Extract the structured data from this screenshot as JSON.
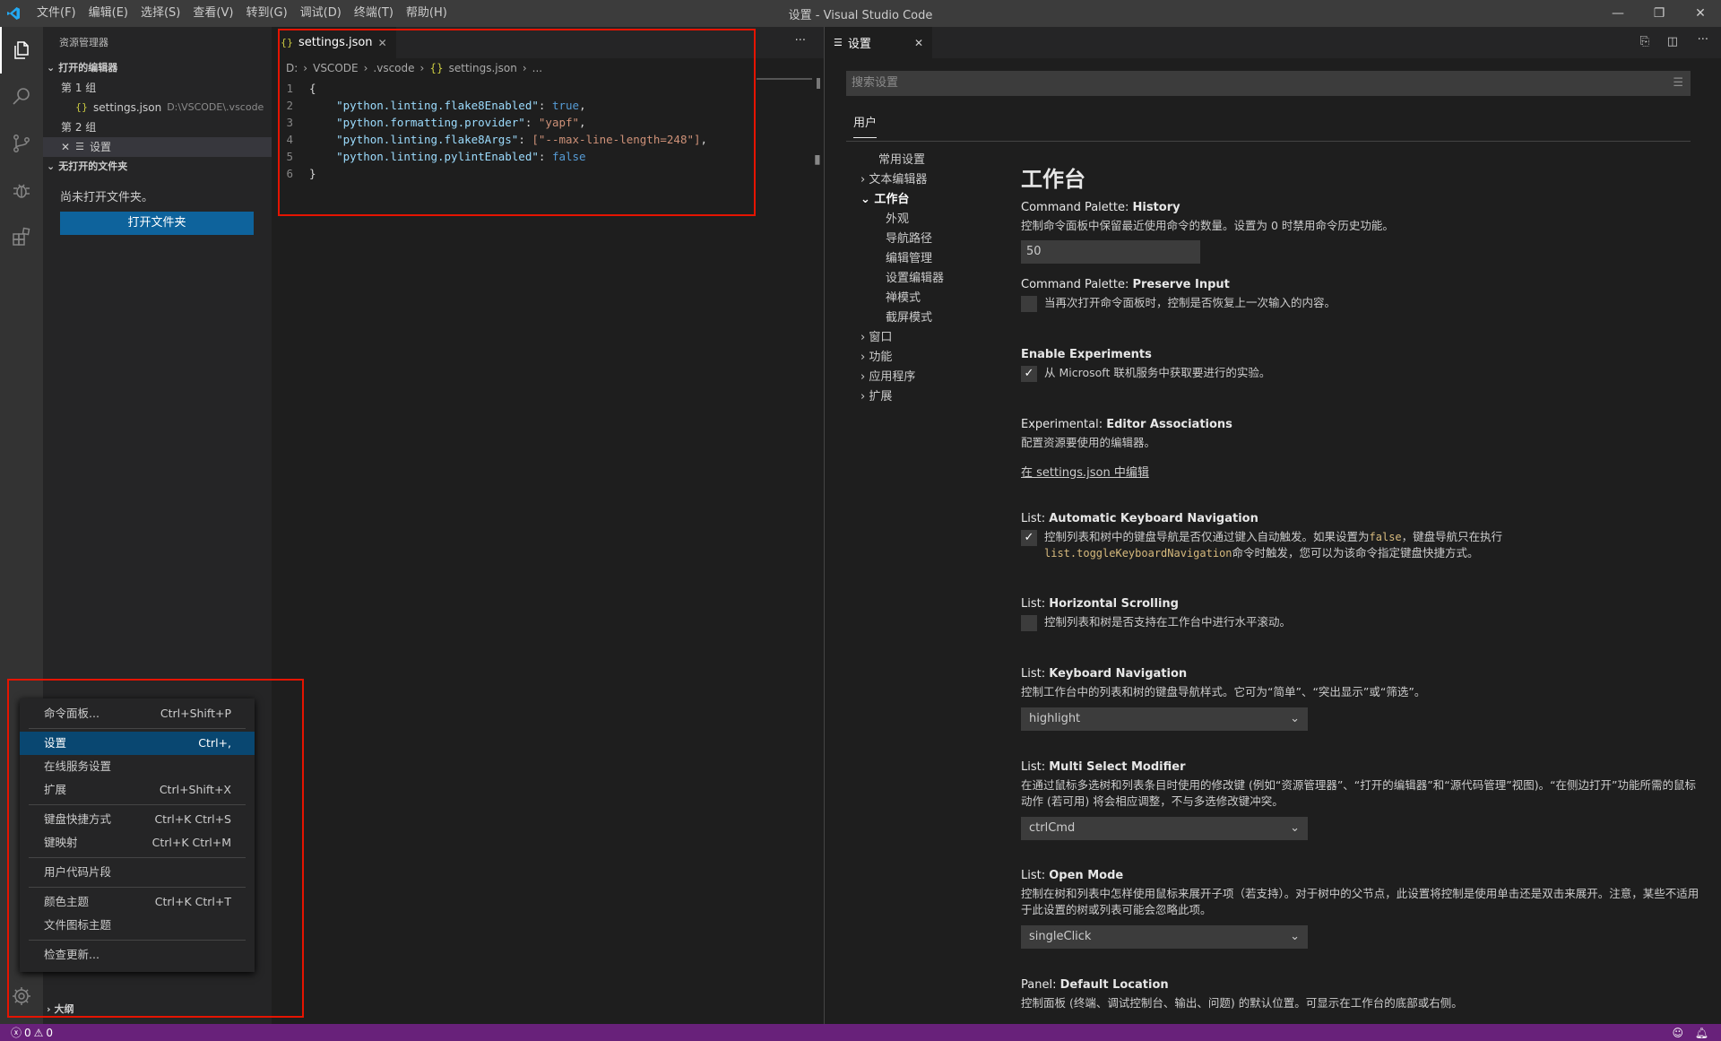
{
  "titlebar": {
    "title": "设置 - Visual Studio Code",
    "menu": [
      "文件(F)",
      "编辑(E)",
      "选择(S)",
      "查看(V)",
      "转到(G)",
      "调试(D)",
      "终端(T)",
      "帮助(H)"
    ],
    "controls": {
      "minimize": "—",
      "restore": "❐",
      "close": "✕"
    }
  },
  "activity_bar": {
    "icons": [
      "files-icon",
      "search-icon",
      "source-control-icon",
      "debug-icon",
      "extensions-icon",
      "gear-icon"
    ]
  },
  "sidebar": {
    "header": "资源管理器",
    "open_editors": {
      "title": "打开的编辑器",
      "groups": [
        {
          "label": "第 1 组",
          "items": [
            {
              "name": "settings.json",
              "path": "D:\\VSCODE\\.vscode"
            }
          ]
        },
        {
          "label": "第 2 组",
          "items": [
            {
              "name": "设置",
              "path": ""
            }
          ]
        }
      ]
    },
    "no_folder": {
      "title": "无打开的文件夹",
      "message": "尚未打开文件夹。",
      "button": "打开文件夹"
    },
    "outline": "大纲"
  },
  "editor": {
    "tab": "settings.json",
    "more": "···",
    "breadcrumb": [
      "D:",
      "VSCODE",
      ".vscode",
      "settings.json",
      "..."
    ],
    "lines": [
      {
        "n": "1",
        "text": "{"
      },
      {
        "n": "2",
        "key": "\"python.linting.flake8Enabled\"",
        "val": "true",
        "type": "kw",
        "end": ","
      },
      {
        "n": "3",
        "key": "\"python.formatting.provider\"",
        "val": "\"yapf\"",
        "type": "str",
        "end": ","
      },
      {
        "n": "4",
        "key": "\"python.linting.flake8Args\"",
        "val": "[\"--max-line-length=248\"]",
        "type": "str",
        "end": ","
      },
      {
        "n": "5",
        "key": "\"python.linting.pylintEnabled\"",
        "val": "false",
        "type": "kw",
        "end": ""
      },
      {
        "n": "6",
        "text": "}"
      }
    ]
  },
  "settings": {
    "tab": "设置",
    "search_placeholder": "搜索设置",
    "scope_tab": "用户",
    "toc": [
      "常用设置",
      "文本编辑器",
      "工作台",
      "外观",
      "导航路径",
      "编辑管理",
      "设置编辑器",
      "禅模式",
      "截屏模式",
      "窗口",
      "功能",
      "应用程序",
      "扩展"
    ],
    "section_title": "工作台",
    "items": [
      {
        "prefix": "Command Palette: ",
        "name": "History",
        "desc": "控制命令面板中保留最近使用命令的数量。设置为 0 时禁用命令历史功能。",
        "value": "50"
      },
      {
        "prefix": "Command Palette: ",
        "name": "Preserve Input",
        "desc": "当再次打开命令面板时，控制是否恢复上一次输入的内容。"
      },
      {
        "prefix": "",
        "name": "Enable Experiments",
        "desc": "从 Microsoft 联机服务中获取要进行的实验。"
      },
      {
        "prefix": "Experimental: ",
        "name": "Editor Associations",
        "desc": "配置资源要使用的编辑器。",
        "link": "在 settings.json 中编辑"
      },
      {
        "prefix": "List: ",
        "name": "Automatic Keyboard Navigation",
        "desc1": "控制列表和树中的键盘导航是否仅通过键入自动触发。如果设置为",
        "code1": "false",
        "desc2": "，键盘导航只在执行",
        "code2": "list.toggleKeyboardNavigation",
        "desc3": "命令时触发，您可以为该命令指定键盘快捷方式。"
      },
      {
        "prefix": "List: ",
        "name": "Horizontal Scrolling",
        "desc": "控制列表和树是否支持在工作台中进行水平滚动。"
      },
      {
        "prefix": "List: ",
        "name": "Keyboard Navigation",
        "desc": "控制工作台中的列表和树的键盘导航样式。它可为“简单”、“突出显示”或“筛选”。",
        "value": "highlight"
      },
      {
        "prefix": "List: ",
        "name": "Multi Select Modifier",
        "desc": "在通过鼠标多选树和列表条目时使用的修改键 (例如“资源管理器”、“打开的编辑器”和“源代码管理”视图)。“在侧边打开”功能所需的鼠标动作 (若可用) 将会相应调整，不与多选修改键冲突。",
        "value": "ctrlCmd"
      },
      {
        "prefix": "List: ",
        "name": "Open Mode",
        "desc": "控制在树和列表中怎样使用鼠标来展开子项（若支持）。对于树中的父节点，此设置将控制是使用单击还是双击来展开。注意，某些不适用于此设置的树或列表可能会忽略此项。",
        "value": "singleClick"
      },
      {
        "prefix": "Panel: ",
        "name": "Default Location",
        "desc": "控制面板 (终端、调试控制台、输出、问题) 的默认位置。可显示在工作台的底部或右侧。"
      }
    ]
  },
  "context_menu": {
    "items": [
      {
        "label": "命令面板...",
        "shortcut": "Ctrl+Shift+P"
      },
      {
        "label": "设置",
        "shortcut": "Ctrl+,"
      },
      {
        "label": "在线服务设置",
        "shortcut": ""
      },
      {
        "label": "扩展",
        "shortcut": "Ctrl+Shift+X"
      },
      {
        "label": "键盘快捷方式",
        "shortcut": "Ctrl+K Ctrl+S"
      },
      {
        "label": "键映射",
        "shortcut": "Ctrl+K Ctrl+M"
      },
      {
        "label": "用户代码片段",
        "shortcut": ""
      },
      {
        "label": "颜色主题",
        "shortcut": "Ctrl+K Ctrl+T"
      },
      {
        "label": "文件图标主题",
        "shortcut": ""
      },
      {
        "label": "检查更新...",
        "shortcut": ""
      }
    ]
  },
  "statusbar": {
    "errors": "0",
    "warnings": "0"
  },
  "colors": {
    "accent": "#0e639c",
    "statusbar": "#68217a",
    "highlight_box": "#e51400"
  }
}
